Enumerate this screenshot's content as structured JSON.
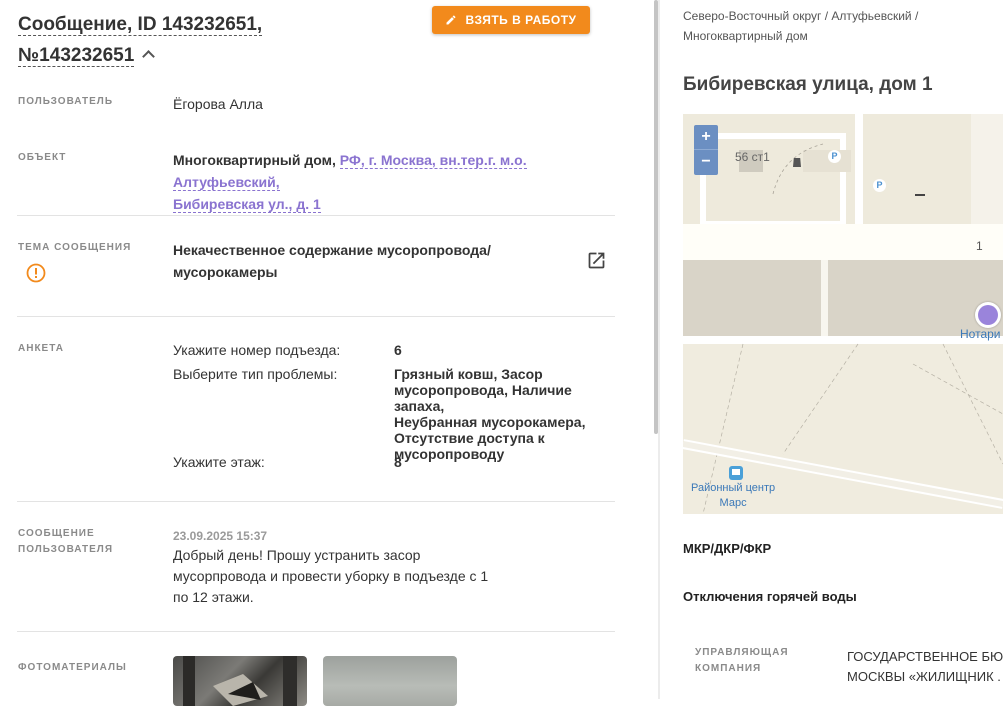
{
  "header": {
    "title_line1": "Сообщение, ID 143232651,",
    "title_line2": "№143232651",
    "take_button": "ВЗЯТЬ В РАБОТУ"
  },
  "fields": {
    "user_label": "ПОЛЬЗОВАТЕЛЬ",
    "user_value": "Ёгорова Алла",
    "object_label": "ОБЪЕКТ",
    "object_prefix": "Многоквартирный дом,",
    "object_link_1": "РФ, г. Москва, вн.тер.г. м.о. Алтуфьевский,",
    "object_link_2": "Бибиревская ул., д. 1",
    "topic_label": "ТЕМА СООБЩЕНИЯ",
    "topic_line1": "Некачественное содержание мусоропровода/",
    "topic_line2": "мусорокамеры",
    "form_label": "АНКЕТА",
    "q1": "Укажите номер подъезда:",
    "a1": "6",
    "q2": "Выберите тип проблемы:",
    "a2_lines": [
      "Грязный ковш, Засор",
      "мусоропровода, Наличие запаха,",
      "Неубранная мусорокамера,",
      "Отсутствие доступа к",
      "мусоропроводу"
    ],
    "q3": "Укажите этаж:",
    "a3": "8",
    "message_label_1": "СООБЩЕНИЕ",
    "message_label_2": "ПОЛЬЗОВАТЕЛЯ",
    "message_date": "23.09.2025 15:37",
    "message_lines": [
      "Добрый день! Прошу устранить засор",
      "мусорпровода и провести уборку в подъезде с 1",
      "по 12 этажи."
    ],
    "photos_label": "ФОТОМАТЕРИАЛЫ"
  },
  "right": {
    "breadcrumb_1": "Северо-Восточный округ / Алтуфьевский /",
    "breadcrumb_2": "Многоквартирный дом",
    "address": "Бибиревская улица, дом 1",
    "map": {
      "zoom_in": "+",
      "zoom_out": "−",
      "bldg_label": "56 ст1",
      "road_number": "1",
      "poi_notary": "Нотари",
      "poi_district_1": "Районный центр",
      "poi_district_2": "Марс"
    },
    "section_mkr": "МКР/ДКР/ФКР",
    "section_hotwater": "Отключения горячей воды",
    "mgmt_label_1": "УПРАВЛЯЮЩАЯ",
    "mgmt_label_2": "КОМПАНИЯ",
    "mgmt_value_1": "ГОСУДАРСТВЕННОЕ БЮ,",
    "mgmt_value_2": "МОСКВЫ «ЖИЛИЩНИК ."
  },
  "colors": {
    "accent_orange": "#f28a1c",
    "link_purple": "#8a73d0"
  },
  "icons": {
    "button": "pencil-icon",
    "title": "chevron-up-icon",
    "topic": "warning-circle-icon",
    "external": "open-external-icon"
  }
}
